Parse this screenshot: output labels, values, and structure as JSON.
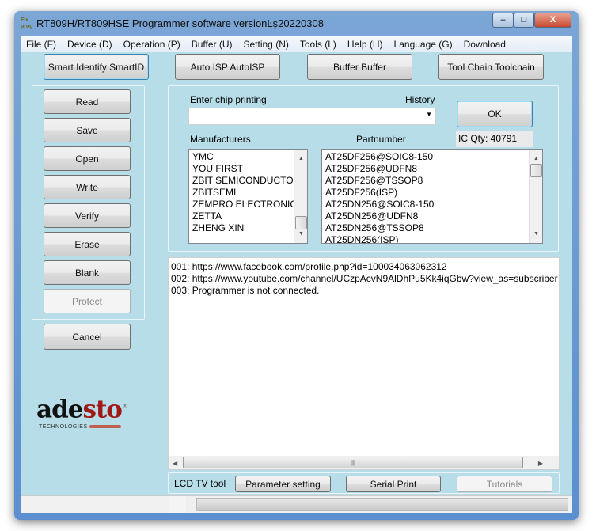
{
  "window": {
    "title": "RT809H/RT809HSE Programmer software versionĿş20220308",
    "icon_text": "Fix prog",
    "minimize": "–",
    "maximize": "□",
    "close": "X"
  },
  "menu": [
    "File (F)",
    "Device (D)",
    "Operation (P)",
    "Buffer (U)",
    "Setting (N)",
    "Tools (L)",
    "Help (H)",
    "Language (G)",
    "Download"
  ],
  "toolbar": [
    "Smart Identify SmartID",
    "Auto ISP AutoISP",
    "Buffer Buffer",
    "Tool Chain Toolchain"
  ],
  "operations": [
    {
      "label": "Read",
      "enabled": true
    },
    {
      "label": "Save",
      "enabled": true
    },
    {
      "label": "Open",
      "enabled": true
    },
    {
      "label": "Write",
      "enabled": true
    },
    {
      "label": "Verify",
      "enabled": true
    },
    {
      "label": "Erase",
      "enabled": true
    },
    {
      "label": "Blank",
      "enabled": true
    },
    {
      "label": "Protect",
      "enabled": false
    }
  ],
  "cancel": "Cancel",
  "logo": {
    "text": "adesto",
    "sub": "TECHNOLOGIES",
    "reg": "®"
  },
  "search": {
    "label": "Enter chip printing",
    "history_label": "History",
    "value": "",
    "ok": "OK",
    "ic_qty": "IC Qty: 40791"
  },
  "manufacturers": {
    "label": "Manufacturers",
    "items": [
      "YMC",
      "YOU FIRST",
      "ZBIT SEMICONDUCTOR",
      "ZBITSEMI",
      "ZEMPRO ELECTRONIC",
      "ZETTA",
      "ZHENG XIN"
    ]
  },
  "partnumber": {
    "label": "Partnumber",
    "items": [
      "AT25DF256@SOIC8-150",
      "AT25DF256@UDFN8",
      "AT25DF256@TSSOP8",
      "AT25DF256(ISP)",
      "AT25DN256@SOIC8-150",
      "AT25DN256@UDFN8",
      "AT25DN256@TSSOP8",
      "AT25DN256(ISP)"
    ]
  },
  "log": [
    "001:  https://www.facebook.com/profile.php?id=100034063062312",
    "002:  https://www.youtube.com/channel/UCzpAcvN9AlDhPu5Kk4iqGbw?view_as=subscriber",
    "003:  Programmer is not connected."
  ],
  "bottom": {
    "lcd_label": "LCD TV tool",
    "param": "Parameter setting",
    "serial": "Serial Print",
    "tutorials": "Tutorials"
  },
  "colors": {
    "client_bg": "#b7dde8",
    "logo_red": "#a01818"
  }
}
